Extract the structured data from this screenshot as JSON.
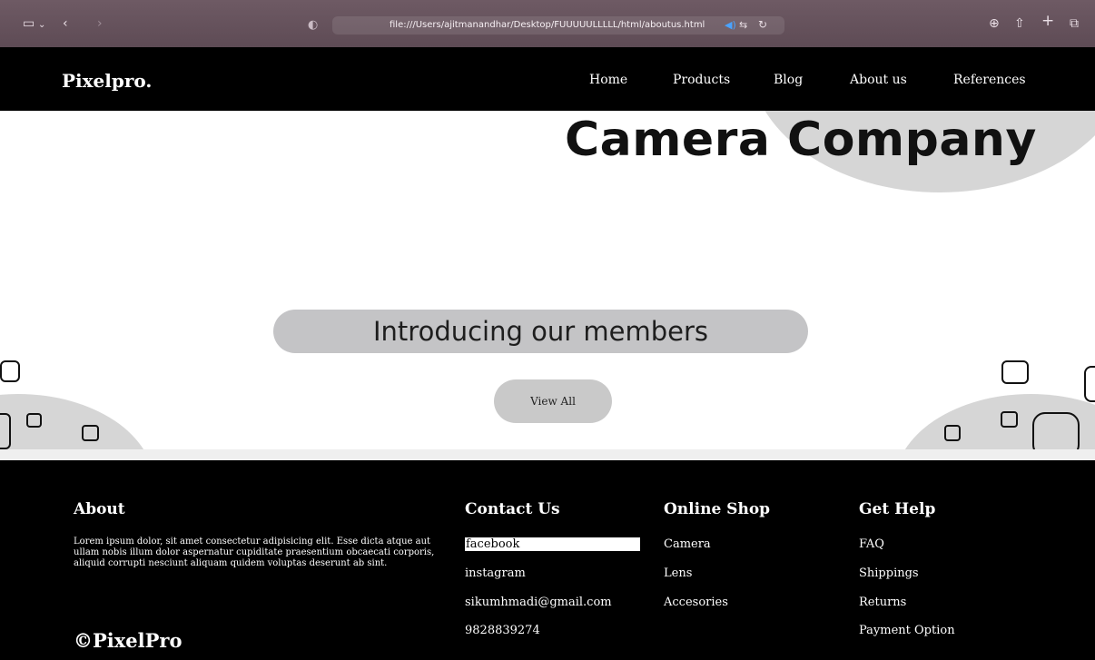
{
  "browser": {
    "url": "file:///Users/ajitmanandhar/Desktop/FUUUUULLLLL/html/aboutus.html"
  },
  "site": {
    "logo": "Pixelpro.",
    "nav": [
      "Home",
      "Products",
      "Blog",
      "About us",
      "References"
    ]
  },
  "hero": {
    "title": "Camera Company",
    "intro": "Introducing our members",
    "button": "View All"
  },
  "footer": {
    "about_heading": "About",
    "about_text": "Lorem ipsum dolor, sit amet consectetur adipisicing elit. Esse dicta atque aut ullam nobis illum dolor aspernatur cupiditate praesentium obcaecati corporis, aliquid corrupti nesciunt aliquam quidem voluptas deserunt ab sint.",
    "copyright": "©PixelPro",
    "contact_heading": "Contact Us",
    "contact": [
      "facebook",
      "instagram",
      "sikumhmadi@gmail.com",
      "9828839274"
    ],
    "shop_heading": "Online Shop",
    "shop": [
      "Camera",
      "Lens",
      "Accesories"
    ],
    "help_heading": "Get Help",
    "help": [
      "FAQ",
      "Shippings",
      "Returns",
      "Payment Option"
    ]
  }
}
